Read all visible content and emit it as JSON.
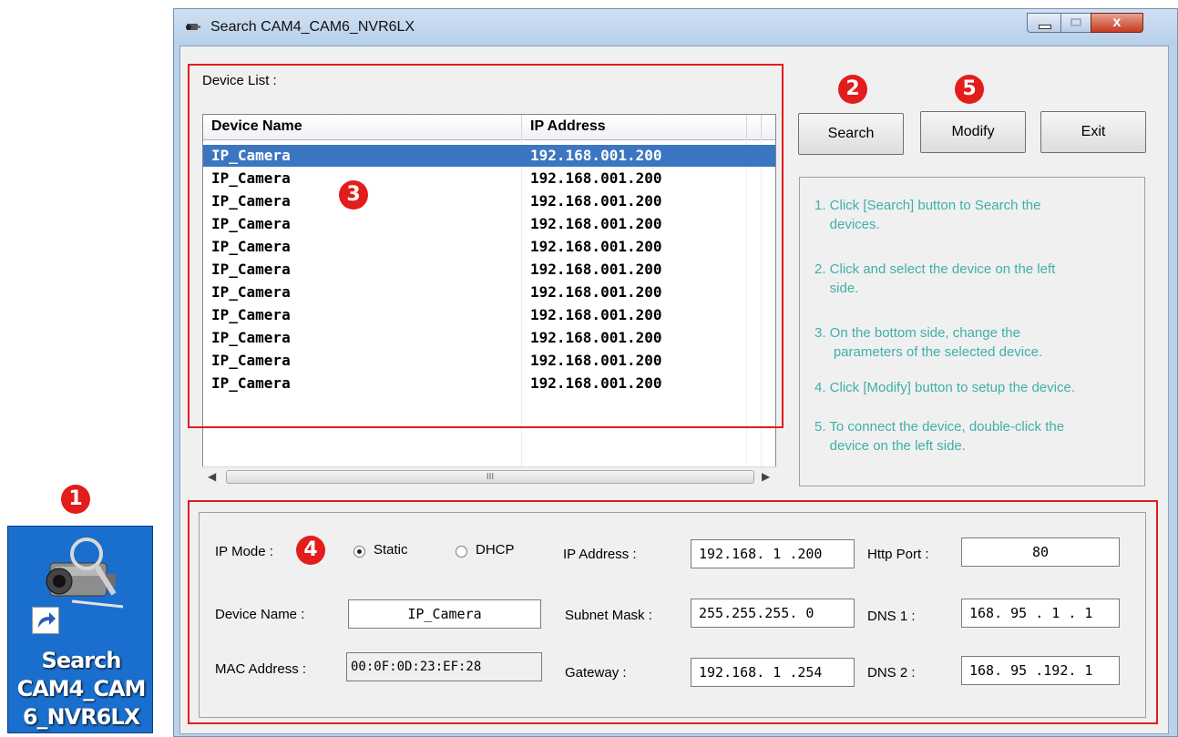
{
  "desktop_shortcut": {
    "label_lines": [
      "Search",
      "CAM4_CAM",
      "6_NVR6LX"
    ]
  },
  "badges": {
    "b1": "1",
    "b2": "2",
    "b3": "3",
    "b4": "4",
    "b5": "5"
  },
  "window": {
    "title": "Search CAM4_CAM6_NVR6LX",
    "close_glyph": "x"
  },
  "device_list": {
    "label": "Device List :",
    "columns": [
      "Device Name",
      "IP Address"
    ],
    "rows": [
      {
        "name": "IP_Camera",
        "ip": "192.168.001.200"
      },
      {
        "name": "IP_Camera",
        "ip": "192.168.001.200"
      },
      {
        "name": "IP_Camera",
        "ip": "192.168.001.200"
      },
      {
        "name": "IP_Camera",
        "ip": "192.168.001.200"
      },
      {
        "name": "IP_Camera",
        "ip": "192.168.001.200"
      },
      {
        "name": "IP_Camera",
        "ip": "192.168.001.200"
      },
      {
        "name": "IP_Camera",
        "ip": "192.168.001.200"
      },
      {
        "name": "IP_Camera",
        "ip": "192.168.001.200"
      },
      {
        "name": "IP_Camera",
        "ip": "192.168.001.200"
      },
      {
        "name": "IP_Camera",
        "ip": "192.168.001.200"
      },
      {
        "name": "IP_Camera",
        "ip": "192.168.001.200"
      }
    ],
    "selected_row": 0,
    "scroll_thumb_glyph": "III"
  },
  "buttons": {
    "search": "Search",
    "modify": "Modify",
    "exit": "Exit"
  },
  "instructions": [
    [
      "1. Click [Search] button to Search the",
      "    devices."
    ],
    [
      "2. Click and select the device on the left",
      "    side."
    ],
    [
      "3. On the bottom side, change the",
      "     parameters of the selected device."
    ],
    [
      "4. Click [Modify] button to setup the device."
    ],
    [
      "5. To connect the device, double-click the",
      "    device on the left side."
    ]
  ],
  "params": {
    "ip_mode_label": "IP Mode :",
    "static_label": "Static",
    "dhcp_label": "DHCP",
    "ip_mode_selected": "Static",
    "device_name_label": "Device Name :",
    "device_name_value": "IP_Camera",
    "mac_label": "MAC Address :",
    "mac_value": "00:0F:0D:23:EF:28",
    "ip_address_label": "IP Address :",
    "ip_address_value": "192.168. 1 .200",
    "subnet_label": "Subnet Mask :",
    "subnet_value": "255.255.255. 0",
    "gateway_label": "Gateway :",
    "gateway_value": "192.168. 1 .254",
    "http_port_label": "Http Port :",
    "http_port_value": "80",
    "dns1_label": "DNS 1 :",
    "dns1_value": "168. 95 . 1 . 1",
    "dns2_label": "DNS 2 :",
    "dns2_value": "168. 95 .192. 1"
  },
  "colors": {
    "annotation_red": "#e31c1c",
    "selection_blue": "#3c76c2",
    "instruction_teal": "#3fb0a7"
  }
}
